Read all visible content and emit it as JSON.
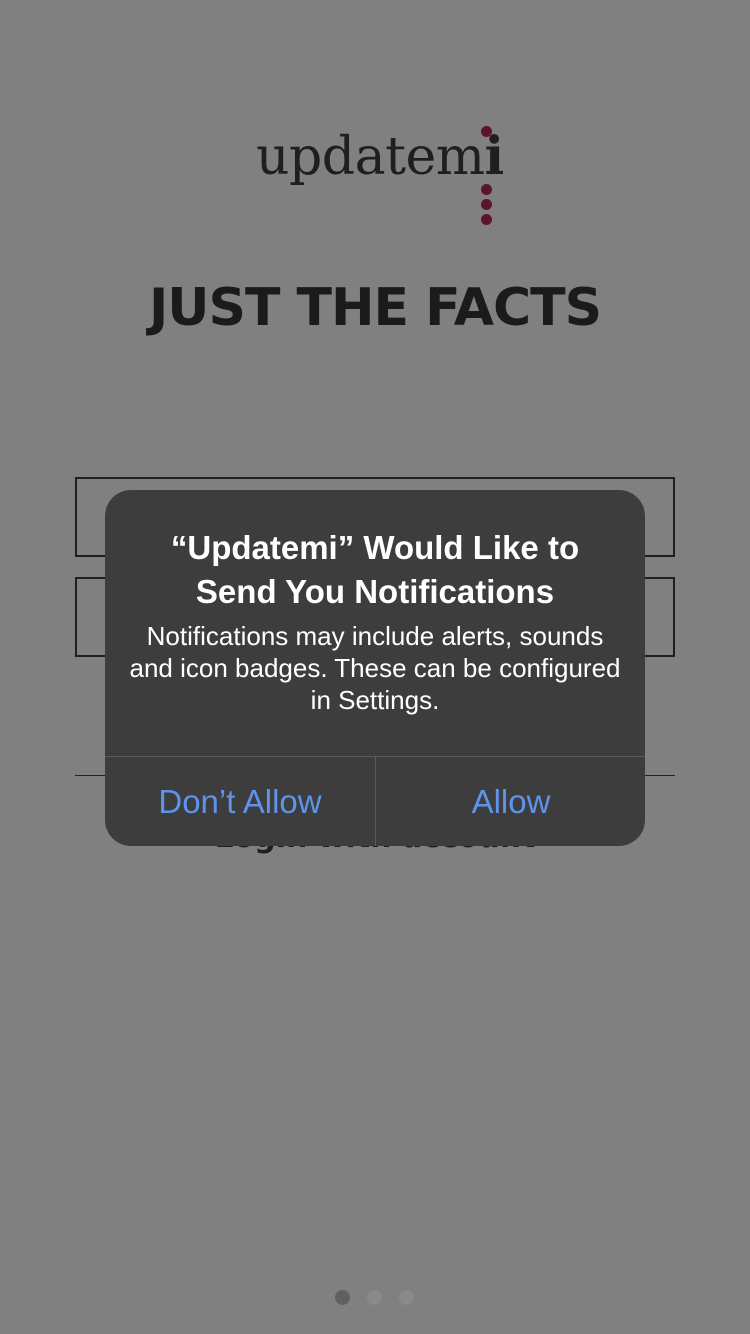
{
  "logo": {
    "text_regular": "updatem",
    "text_bold": "i",
    "accent_color": "#5b1530"
  },
  "tagline": "JUST THE FACTS",
  "login_link": "Login with account",
  "alert": {
    "title_line1": "“Updatemi” Would Like to",
    "title_line2": "Send You Notifications",
    "message": "Notifications may include alerts, sounds and icon badges. These can be configured in Settings.",
    "deny_label": "Don’t Allow",
    "allow_label": "Allow",
    "button_color": "#5d93ea"
  },
  "pager": {
    "count": 3,
    "active_index": 0
  }
}
